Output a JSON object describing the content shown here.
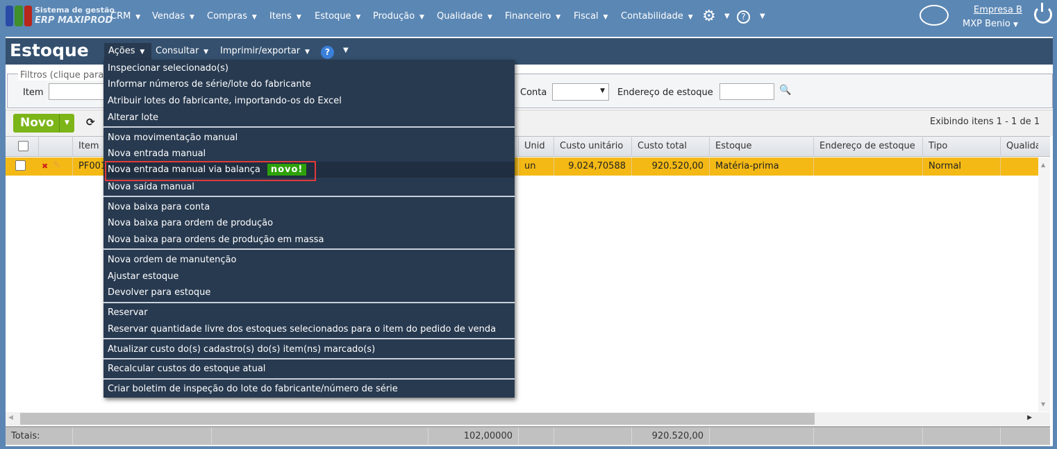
{
  "brand": {
    "line1": "Sistema de gestão",
    "line2": "ERP MAXIPROD"
  },
  "nav": [
    "CRM",
    "Vendas",
    "Compras",
    "Itens",
    "Estoque",
    "Produção",
    "Qualidade",
    "Financeiro",
    "Fiscal",
    "Contabilidade"
  ],
  "user": {
    "company": "Empresa B",
    "name": "MXP Benio"
  },
  "page": {
    "title": "Estoque",
    "menus": [
      "Ações",
      "Consultar",
      "Imprimir/exportar"
    ]
  },
  "filters": {
    "legend": "Filtros (clique para",
    "item_label": "Item",
    "conta_label": "Conta",
    "endereco_label": "Endereço de estoque"
  },
  "toolbar": {
    "novo": "Novo",
    "status": "Exibindo itens 1 - 1 de 1"
  },
  "table": {
    "headers": {
      "item": "Item",
      "unid": "Unid",
      "custo_unit": "Custo unitário",
      "custo_total": "Custo total",
      "estoque": "Estoque",
      "endereco": "Endereço de estoque",
      "tipo": "Tipo",
      "qualidade": "Qualida"
    },
    "row": {
      "item": "PF001",
      "unid": "un",
      "custo_unit": "9.024,70588",
      "custo_total": "920.520,00",
      "estoque": "Matéria-prima",
      "endereco": "",
      "tipo": "Normal"
    },
    "totals": {
      "label": "Totais:",
      "quantidade": "102,00000",
      "custo_total": "920.520,00"
    }
  },
  "menu": {
    "items": [
      "Inspecionar selecionado(s)",
      "Informar números de série/lote do fabricante",
      "Atribuir lotes do fabricante, importando-os do Excel",
      "Alterar lote",
      "Nova movimentação manual",
      "Nova entrada manual",
      "Nova entrada manual via balança",
      "Nova saída manual",
      "Nova baixa para conta",
      "Nova baixa para ordem de produção",
      "Nova baixa para ordens de produção em massa",
      "Nova ordem de manutenção",
      "Ajustar estoque",
      "Devolver para estoque",
      "Reservar",
      "Reservar quantidade livre dos estoques selecionados para o item do pedido de venda",
      "Atualizar custo do(s) cadastro(s) do(s) item(ns) marcado(s)",
      "Recalcular custos do estoque atual",
      "Criar boletim de inspeção do lote do fabricante/número de série"
    ],
    "badge": "novo!"
  }
}
